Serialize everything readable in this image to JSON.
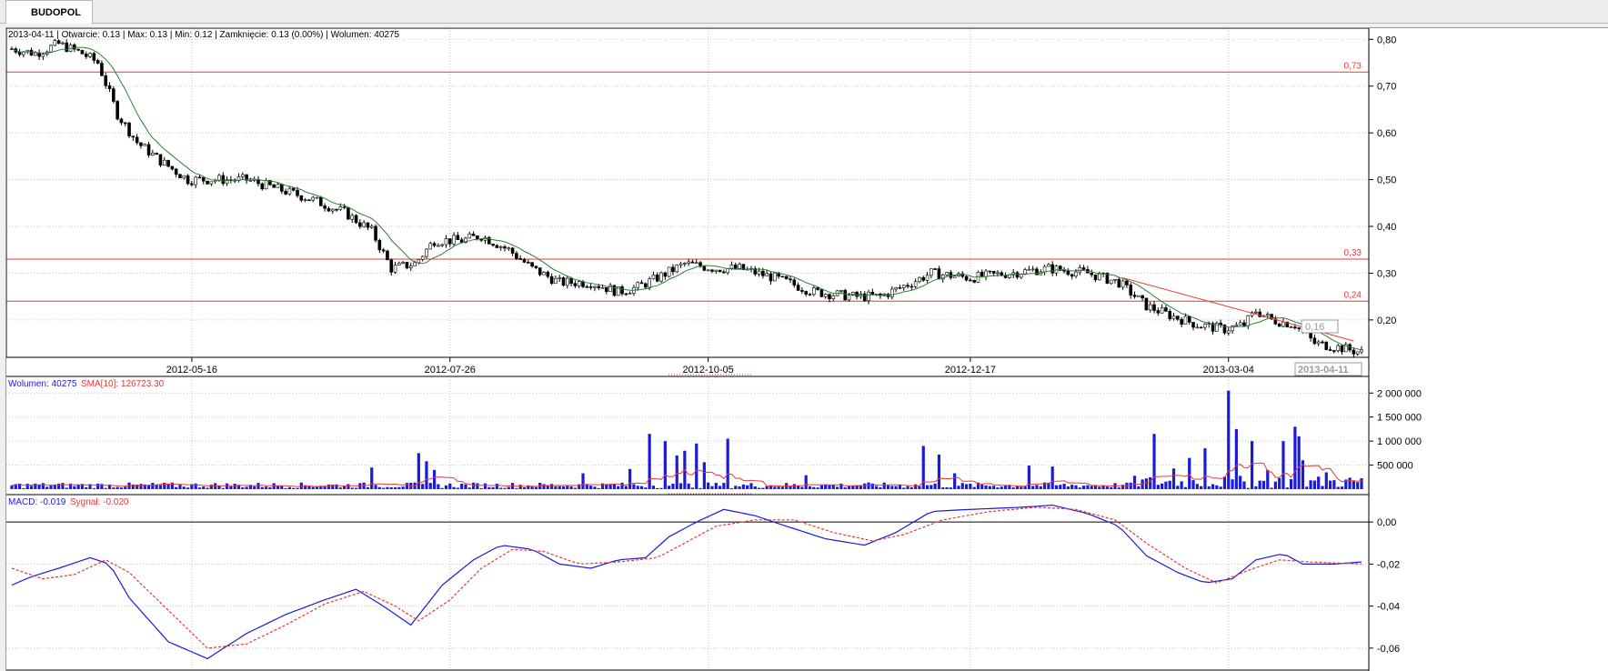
{
  "tab": {
    "label": "BUDOPOL"
  },
  "price_info": "2013-04-11 | Otwarcie: 0.13 | Max: 0.13 | Min: 0.12 | Zamknięcie: 0.13 (0.00%) | Wolumen: 40275",
  "volume_info": {
    "label": "Wolumen: 40275",
    "sma_label": "SMA[10]: 126723.30"
  },
  "macd_info": {
    "label": "MACD: -0.019",
    "signal_label": "Sygnał: -0.020"
  },
  "colors": {
    "candle_up": "#ffffff",
    "candle_down": "#000000",
    "sma_price": "#2e7d32",
    "resistance": "#e53935",
    "volume_bar": "#1a1adb",
    "volume_sma": "#e53935",
    "macd": "#1a1adb",
    "signal": "#e53935",
    "grid": "#c8c8c8"
  },
  "chart_data": [
    {
      "type": "candlestick",
      "ylim": [
        0.12,
        0.82
      ],
      "y_ticks": [
        "0,80",
        "0,70",
        "0,60",
        "0,50",
        "0,40",
        "0,30",
        "0,20"
      ],
      "y_tick_values": [
        0.8,
        0.7,
        0.6,
        0.5,
        0.4,
        0.3,
        0.2
      ],
      "x_tick_labels": [
        "2012-05-16",
        "2012-07-26",
        "2012-10-05",
        "2012-12-17",
        "2013-03-04"
      ],
      "x_tick_index": [
        46,
        112,
        178,
        245,
        311
      ],
      "last_date_label": "2013-04-11",
      "last_price_label": "0,16",
      "hlines": [
        {
          "value": 0.73,
          "label": "0,73"
        },
        {
          "value": 0.33,
          "label": "0,33"
        },
        {
          "value": 0.24,
          "label": "0,24"
        }
      ],
      "trendline": [
        {
          "index": 284,
          "value": 0.29
        },
        {
          "index": 343,
          "value": 0.155
        }
      ],
      "anchors": [
        [
          0,
          0.78
        ],
        [
          6,
          0.77
        ],
        [
          12,
          0.79
        ],
        [
          18,
          0.77
        ],
        [
          22,
          0.75
        ],
        [
          27,
          0.64
        ],
        [
          32,
          0.58
        ],
        [
          38,
          0.54
        ],
        [
          45,
          0.5
        ],
        [
          52,
          0.5
        ],
        [
          60,
          0.5
        ],
        [
          68,
          0.48
        ],
        [
          76,
          0.46
        ],
        [
          85,
          0.43
        ],
        [
          92,
          0.39
        ],
        [
          97,
          0.31
        ],
        [
          103,
          0.32
        ],
        [
          108,
          0.37
        ],
        [
          115,
          0.37
        ],
        [
          120,
          0.38
        ],
        [
          127,
          0.35
        ],
        [
          133,
          0.31
        ],
        [
          140,
          0.28
        ],
        [
          148,
          0.28
        ],
        [
          155,
          0.26
        ],
        [
          160,
          0.27
        ],
        [
          165,
          0.29
        ],
        [
          172,
          0.32
        ],
        [
          180,
          0.31
        ],
        [
          186,
          0.31
        ],
        [
          195,
          0.29
        ],
        [
          205,
          0.26
        ],
        [
          215,
          0.25
        ],
        [
          222,
          0.25
        ],
        [
          230,
          0.28
        ],
        [
          235,
          0.3
        ],
        [
          245,
          0.29
        ],
        [
          255,
          0.3
        ],
        [
          265,
          0.31
        ],
        [
          275,
          0.3
        ],
        [
          283,
          0.28
        ],
        [
          290,
          0.23
        ],
        [
          296,
          0.21
        ],
        [
          303,
          0.19
        ],
        [
          310,
          0.18
        ],
        [
          315,
          0.19
        ],
        [
          318,
          0.22
        ],
        [
          322,
          0.2
        ],
        [
          328,
          0.19
        ],
        [
          333,
          0.15
        ],
        [
          340,
          0.14
        ],
        [
          345,
          0.13
        ]
      ]
    },
    {
      "type": "bar",
      "series_name": "Wolumen",
      "ylim": [
        0,
        2100000
      ],
      "y_ticks": [
        "2 000 000",
        "1 500 000",
        "1 000 000",
        "500 000"
      ],
      "y_tick_values": [
        2000000,
        1500000,
        1000000,
        500000
      ],
      "spikes": [
        [
          92,
          450000
        ],
        [
          104,
          750000
        ],
        [
          106,
          580000
        ],
        [
          108,
          400000
        ],
        [
          146,
          330000
        ],
        [
          158,
          420000
        ],
        [
          163,
          1150000
        ],
        [
          167,
          1000000
        ],
        [
          170,
          700000
        ],
        [
          172,
          800000
        ],
        [
          175,
          950000
        ],
        [
          177,
          560000
        ],
        [
          183,
          1050000
        ],
        [
          203,
          290000
        ],
        [
          233,
          900000
        ],
        [
          237,
          720000
        ],
        [
          241,
          330000
        ],
        [
          260,
          490000
        ],
        [
          266,
          470000
        ],
        [
          292,
          1150000
        ],
        [
          297,
          430000
        ],
        [
          301,
          650000
        ],
        [
          305,
          850000
        ],
        [
          311,
          2050000
        ],
        [
          313,
          1250000
        ],
        [
          317,
          1000000
        ],
        [
          321,
          400000
        ],
        [
          325,
          1000000
        ],
        [
          328,
          1300000
        ],
        [
          329,
          1100000
        ],
        [
          330,
          600000
        ],
        [
          336,
          350000
        ]
      ]
    },
    {
      "type": "line",
      "ylim": [
        -0.07,
        0.01
      ],
      "y_ticks": [
        "0,00",
        "-0,02",
        "-0,04",
        "-0,06"
      ],
      "y_tick_values": [
        0.0,
        -0.02,
        -0.04,
        -0.06
      ],
      "series": [
        {
          "name": "MACD",
          "points": [
            [
              0,
              -0.03
            ],
            [
              5,
              -0.026
            ],
            [
              12,
              -0.022
            ],
            [
              20,
              -0.017
            ],
            [
              25,
              -0.02
            ],
            [
              30,
              -0.036
            ],
            [
              40,
              -0.057
            ],
            [
              50,
              -0.065
            ],
            [
              60,
              -0.053
            ],
            [
              70,
              -0.044
            ],
            [
              80,
              -0.037
            ],
            [
              88,
              -0.032
            ],
            [
              95,
              -0.04
            ],
            [
              102,
              -0.049
            ],
            [
              110,
              -0.03
            ],
            [
              118,
              -0.018
            ],
            [
              125,
              -0.011
            ],
            [
              133,
              -0.013
            ],
            [
              140,
              -0.02
            ],
            [
              148,
              -0.022
            ],
            [
              155,
              -0.018
            ],
            [
              162,
              -0.017
            ],
            [
              168,
              -0.007
            ],
            [
              175,
              0.0
            ],
            [
              182,
              0.006
            ],
            [
              190,
              0.003
            ],
            [
              198,
              -0.002
            ],
            [
              208,
              -0.008
            ],
            [
              218,
              -0.011
            ],
            [
              226,
              -0.005
            ],
            [
              235,
              0.005
            ],
            [
              245,
              0.006
            ],
            [
              258,
              0.007
            ],
            [
              266,
              0.008
            ],
            [
              275,
              0.004
            ],
            [
              283,
              -0.002
            ],
            [
              290,
              -0.016
            ],
            [
              298,
              -0.024
            ],
            [
              305,
              -0.029
            ],
            [
              312,
              -0.027
            ],
            [
              318,
              -0.018
            ],
            [
              325,
              -0.015
            ],
            [
              330,
              -0.02
            ],
            [
              338,
              -0.02
            ],
            [
              345,
              -0.019
            ]
          ]
        },
        {
          "name": "Sygnał",
          "points": [
            [
              0,
              -0.022
            ],
            [
              8,
              -0.027
            ],
            [
              16,
              -0.025
            ],
            [
              24,
              -0.018
            ],
            [
              30,
              -0.024
            ],
            [
              40,
              -0.042
            ],
            [
              50,
              -0.06
            ],
            [
              60,
              -0.058
            ],
            [
              70,
              -0.049
            ],
            [
              80,
              -0.039
            ],
            [
              90,
              -0.033
            ],
            [
              98,
              -0.04
            ],
            [
              104,
              -0.047
            ],
            [
              112,
              -0.037
            ],
            [
              120,
              -0.022
            ],
            [
              128,
              -0.013
            ],
            [
              136,
              -0.014
            ],
            [
              145,
              -0.02
            ],
            [
              155,
              -0.019
            ],
            [
              165,
              -0.017
            ],
            [
              172,
              -0.01
            ],
            [
              180,
              -0.002
            ],
            [
              190,
              0.001
            ],
            [
              200,
              0.001
            ],
            [
              210,
              -0.005
            ],
            [
              220,
              -0.009
            ],
            [
              228,
              -0.006
            ],
            [
              238,
              0.001
            ],
            [
              250,
              0.005
            ],
            [
              262,
              0.007
            ],
            [
              272,
              0.006
            ],
            [
              282,
              0.001
            ],
            [
              290,
              -0.01
            ],
            [
              300,
              -0.022
            ],
            [
              308,
              -0.029
            ],
            [
              316,
              -0.023
            ],
            [
              324,
              -0.018
            ],
            [
              332,
              -0.019
            ],
            [
              345,
              -0.02
            ]
          ]
        }
      ]
    }
  ]
}
